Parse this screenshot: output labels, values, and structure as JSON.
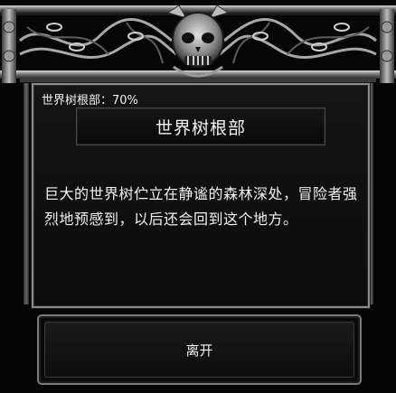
{
  "dialog": {
    "progress_text": "世界树根部：70%",
    "title": "世界树根部",
    "description": "巨大的世界树伫立在静谧的森林深处，冒险者强烈地预感到，以后还会回到这个地方。",
    "leave_label": "离开"
  },
  "decoration": {
    "ornament": "skull-ornament-icon",
    "accent_color": "#8a8a8a"
  }
}
